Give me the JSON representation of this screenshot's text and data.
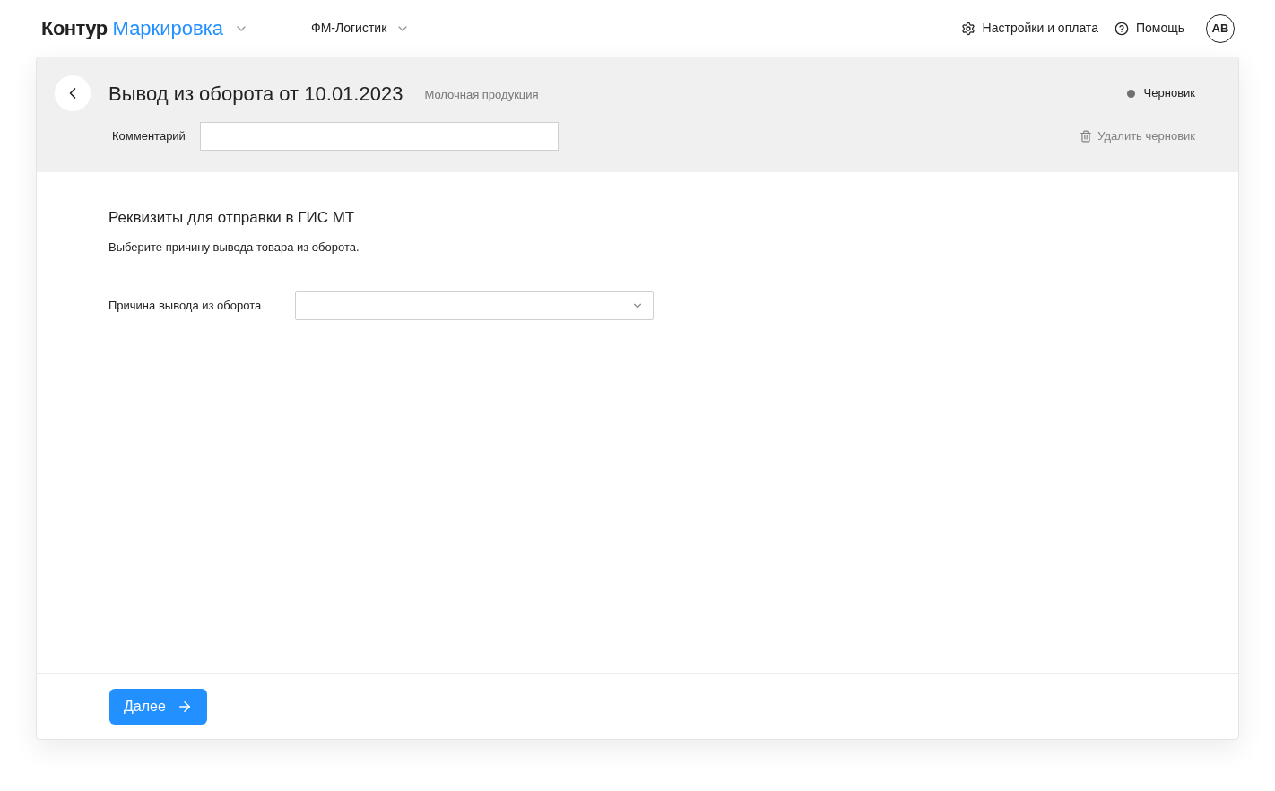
{
  "header": {
    "brand": "Контур",
    "product": "Маркировка",
    "organization": "ФМ-Логистик",
    "settings": "Настройки и оплата",
    "help": "Помощь",
    "avatar": "AB"
  },
  "document": {
    "title": "Вывод из оборота от 10.01.2023",
    "category": "Молочная продукция",
    "status": "Черновик",
    "comment_label": "Комментарий",
    "delete": "Удалить черновик"
  },
  "requisites": {
    "heading": "Реквизиты для отправки в ГИС МТ",
    "description": "Выберите причину вывода товара из оборота.",
    "reason_label": "Причина вывода из оборота"
  },
  "footer": {
    "next": "Далее"
  }
}
